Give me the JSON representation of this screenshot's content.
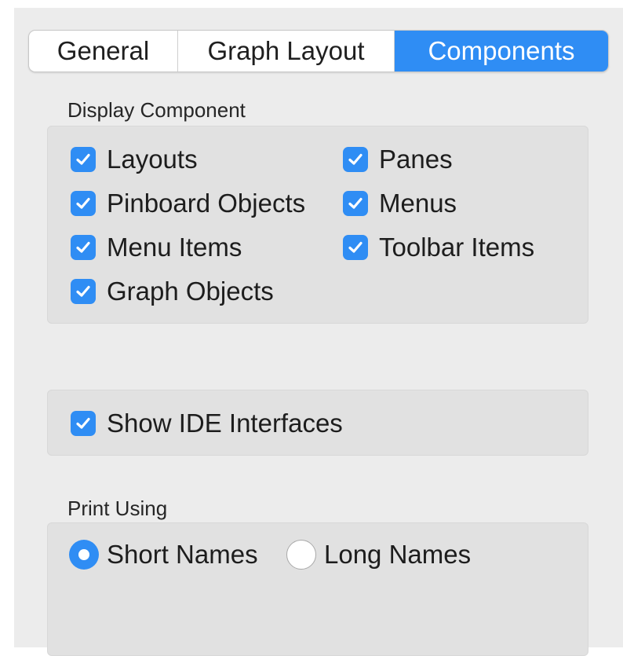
{
  "tabs": [
    {
      "label": "General",
      "selected": false
    },
    {
      "label": "Graph Layout",
      "selected": false
    },
    {
      "label": "Components",
      "selected": true
    }
  ],
  "display_component": {
    "label": "Display Component",
    "items": [
      {
        "label": "Layouts",
        "checked": true
      },
      {
        "label": "Panes",
        "checked": true
      },
      {
        "label": "Pinboard Objects",
        "checked": true
      },
      {
        "label": "Menus",
        "checked": true
      },
      {
        "label": "Menu Items",
        "checked": true
      },
      {
        "label": "Toolbar Items",
        "checked": true
      },
      {
        "label": "Graph Objects",
        "checked": true
      }
    ]
  },
  "ide": {
    "label": "Show IDE Interfaces",
    "checked": true
  },
  "print_using": {
    "label": "Print Using",
    "options": [
      {
        "label": "Short Names",
        "selected": true
      },
      {
        "label": "Long Names",
        "selected": false
      }
    ]
  },
  "colors": {
    "accent": "#2f8df4",
    "panel": "#ececec",
    "group_box": "#e1e1e1"
  }
}
